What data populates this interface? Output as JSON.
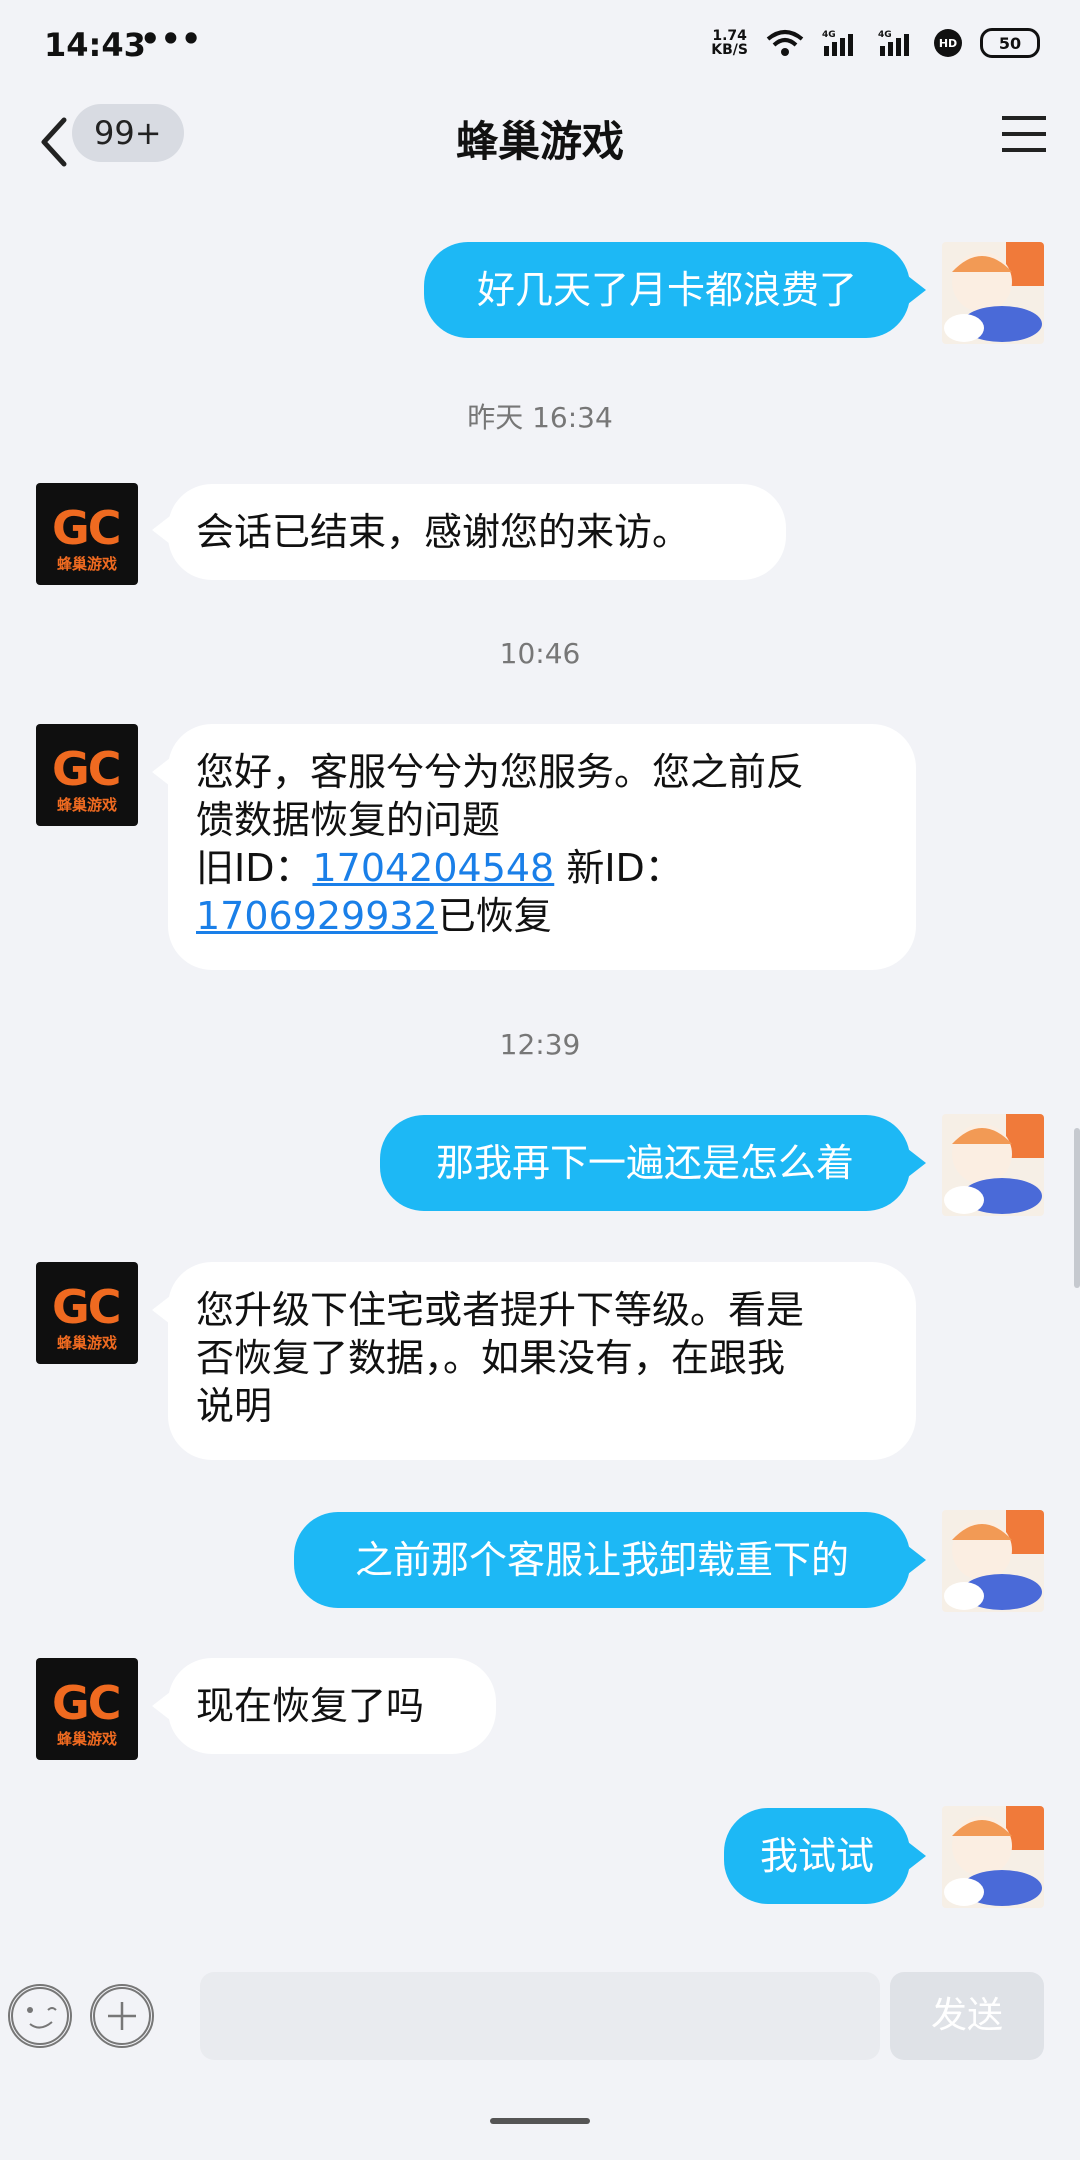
{
  "status": {
    "time": "14:43",
    "dots": "•••",
    "netspeed_value": "1.74",
    "netspeed_unit": "KB/S",
    "battery": "50",
    "hd": "HD"
  },
  "nav": {
    "back_icon": "chevron-left-icon",
    "unread_badge": "99+",
    "title": "蜂巢游戏",
    "menu_icon": "menu-icon"
  },
  "agent_avatar": {
    "mark": "GC",
    "subtitle": "蜂巢游戏"
  },
  "messages": {
    "m1": "好几天了月卡都浪费了",
    "ts1": "昨天 16:34",
    "m2": "会话已结束，感谢您的来访。",
    "ts2": "10:46",
    "m3_line1": "您好，客服兮兮为您服务。您之前反",
    "m3_line2": "馈数据恢复的问题",
    "m3_old_label": "旧ID：",
    "m3_old_id": "1704204548",
    "m3_new_label": " 新ID：",
    "m3_new_id": "1706929932",
    "m3_suffix": "已恢复",
    "ts3": "12:39",
    "m4": "那我再下一遍还是怎么着",
    "m5_line1": "您升级下住宅或者提升下等级。看是",
    "m5_line2": "否恢复了数据，。如果没有，在跟我",
    "m5_line3": "说明",
    "m6": "之前那个客服让我卸载重下的",
    "m7": "现在恢复了吗",
    "m8": "我试试"
  },
  "input": {
    "emoji_icon": "emoji-icon",
    "plus_icon": "plus-icon",
    "send_label": "发送"
  },
  "colors": {
    "bubble_right": "#1db8f5",
    "link": "#1a7fe8",
    "brand_orange": "#ef6a20"
  }
}
